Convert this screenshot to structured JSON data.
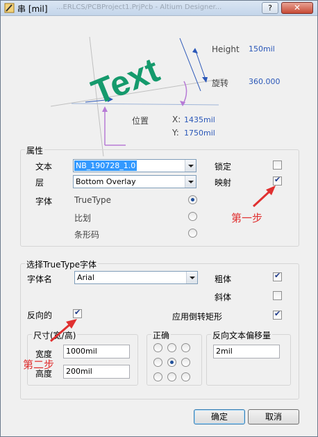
{
  "window": {
    "title": "串 [mil]",
    "ghost_title": "...ERLCS/PCBProject1.PrjPcb - Altium Designer...",
    "help": "?",
    "close": "✕"
  },
  "preview": {
    "sample_text": "Text",
    "height_label": "Height",
    "height_value": "150mil",
    "rotation_label": "旋转",
    "rotation_value": "360.000",
    "position_label": "位置",
    "x_label": "X:",
    "x_value": "1435mil",
    "y_label": "Y:",
    "y_value": "1750mil"
  },
  "properties": {
    "group_title": "属性",
    "text_label": "文本",
    "text_value": "NB_190728_1.0",
    "layer_label": "层",
    "layer_value": "Bottom Overlay",
    "font_label": "字体",
    "font_options": [
      "TrueType",
      "比划",
      "条形码"
    ],
    "selected_font": "TrueType",
    "locked_label": "锁定",
    "locked": false,
    "mirror_label": "映射",
    "mirror": true
  },
  "truetype": {
    "group_title": "选择TrueType字体",
    "font_name_label": "字体名",
    "font_name_value": "Arial",
    "bold_label": "粗体",
    "bold": true,
    "italic_label": "斜体",
    "italic": false,
    "inverted_label": "反向的",
    "inverted": true,
    "inverted_rect_label": "应用倒转矩形",
    "inverted_rect": true,
    "size_group_title": "尺寸(宽/高)",
    "width_label": "宽度",
    "width_value": "1000mil",
    "height_label": "高度",
    "height_value": "200mil",
    "justify_group_title": "正确",
    "justify_selected": 4,
    "offset_group_title": "反向文本偏移量",
    "offset_value": "2mil"
  },
  "annotations": {
    "step1": "第一步",
    "step2": "第二步"
  },
  "buttons": {
    "ok": "确定",
    "cancel": "取消"
  },
  "colors": {
    "text_green": "#159a6c",
    "dim_blue": "#2a57b8",
    "dim_purple": "#b77ad6",
    "annot_red": "#e03030"
  }
}
